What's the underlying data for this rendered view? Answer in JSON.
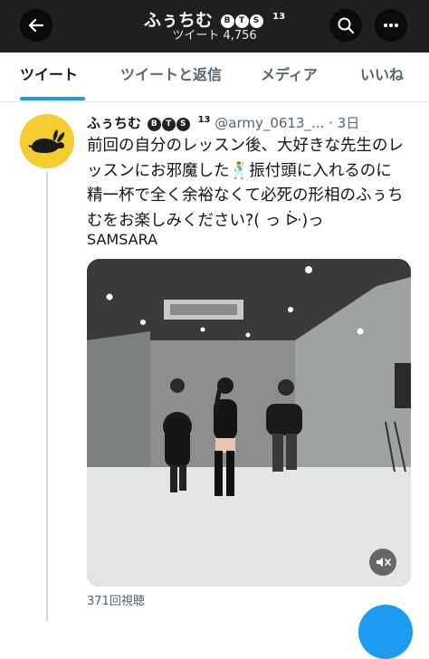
{
  "header": {
    "display_name": "ふぅちむ",
    "badges": [
      "B",
      "T",
      "S"
    ],
    "badge_sup": "13",
    "tweets_label": "ツイート",
    "tweet_count": "4,756"
  },
  "tabs": [
    {
      "label": "ツイート",
      "active": true
    },
    {
      "label": "ツイートと返信",
      "active": false
    },
    {
      "label": "メディア",
      "active": false
    },
    {
      "label": "いいね",
      "active": false
    }
  ],
  "tweet": {
    "display_name": "ふぅちむ",
    "badges": [
      "B",
      "T",
      "S"
    ],
    "badge_sup": "13",
    "handle": "@army_0613_...",
    "separator": "·",
    "time": "3日",
    "text_lines": [
      "前回の自分のレッスン後、大好きな先生のレ",
      "ッスンにお邪魔した🕺振付頭に入れるのに",
      "精一杯で全く余裕なくて必死の形相のふぅち",
      "むをお楽しみください?( っ ᐕ)っ"
    ],
    "tag": "SAMSARA",
    "views": "371回視聴"
  },
  "icons": {
    "back": "arrow-left-icon",
    "search": "search-icon",
    "more": "more-icon",
    "avatar": "rabbit-icon",
    "mute": "speaker-mute-icon",
    "cc": "closed-caption-icon",
    "compose": "compose-icon"
  },
  "colors": {
    "accent": "#1d9bf0",
    "header_bg": "#1f1f1f",
    "avatar_bg": "#f5cc2f"
  }
}
